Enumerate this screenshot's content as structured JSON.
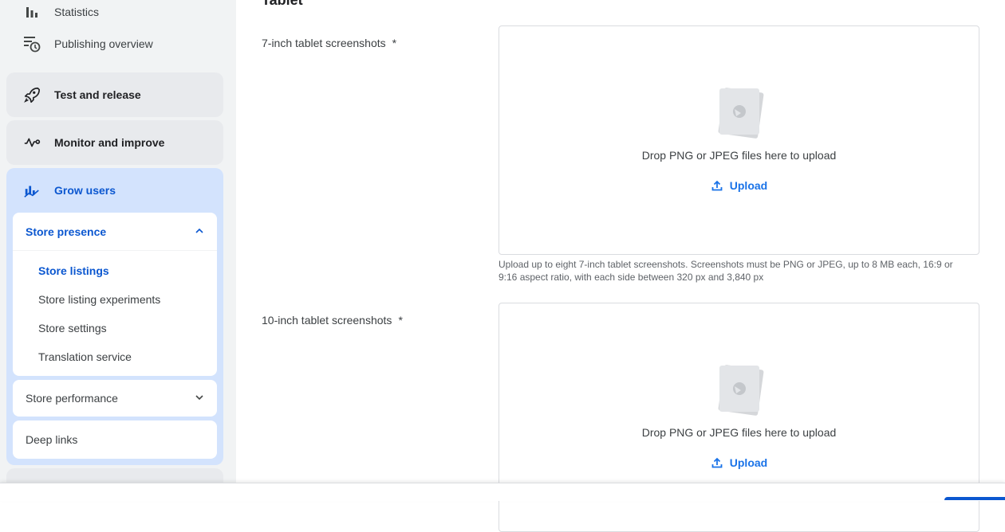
{
  "sidebar": {
    "top_items": [
      {
        "label": "Statistics",
        "icon": "bar-chart-icon"
      },
      {
        "label": "Publishing overview",
        "icon": "schedule-list-icon"
      }
    ],
    "sections": [
      {
        "label": "Test and release",
        "icon": "rocket-icon"
      },
      {
        "label": "Monitor and improve",
        "icon": "pulse-icon"
      }
    ],
    "grow_users": {
      "label": "Grow users",
      "icon": "growth-chart-icon",
      "store_presence": {
        "label": "Store presence",
        "links": [
          "Store listings",
          "Store listing experiments",
          "Store settings",
          "Translation service"
        ],
        "active_link": "Store listings"
      },
      "store_performance": {
        "label": "Store performance"
      },
      "deep_links": {
        "label": "Deep links"
      }
    }
  },
  "main": {
    "section_title": "Tablet",
    "fields": [
      {
        "label": "7-inch tablet screenshots",
        "required_mark": "*",
        "drop_text": "Drop PNG or JPEG files here to upload",
        "upload_label": "Upload",
        "help_line1": "Upload up to eight 7-inch tablet screenshots. Screenshots must be PNG or JPEG, up to 8 MB each, 16:9 or",
        "help_line2": "9:16 aspect ratio, with each side between 320 px and 3,840 px"
      },
      {
        "label": "10-inch tablet screenshots",
        "required_mark": "*",
        "drop_text": "Drop PNG or JPEG files here to upload",
        "upload_label": "Upload"
      }
    ]
  },
  "colors": {
    "accent": "#0b57d0",
    "link": "#1a73e8",
    "sidebar_bg": "#f1f3f4",
    "active_section_bg": "#d3e3fd"
  }
}
